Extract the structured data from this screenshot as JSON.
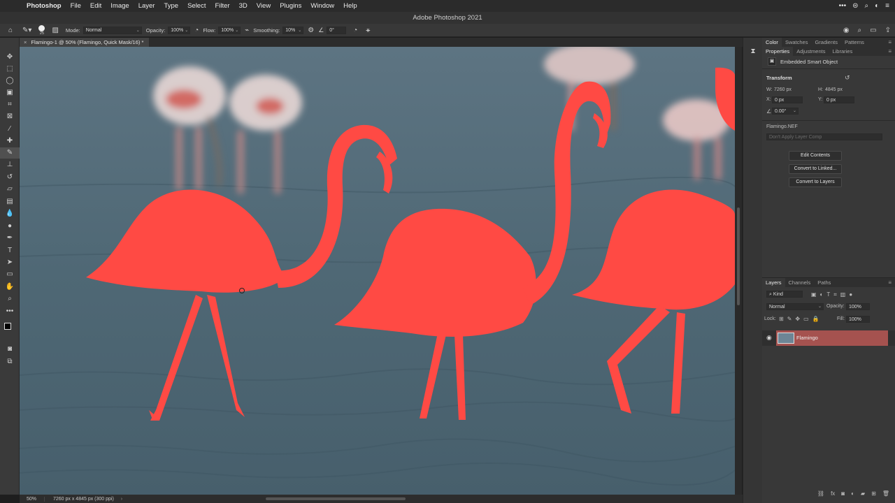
{
  "menubar": {
    "apple": "",
    "app_name": "Photoshop",
    "items": [
      "File",
      "Edit",
      "Image",
      "Layer",
      "Type",
      "Select",
      "Filter",
      "3D",
      "View",
      "Plugins",
      "Window",
      "Help"
    ]
  },
  "window": {
    "title": "Adobe Photoshop 2021"
  },
  "options": {
    "brush_size": "25",
    "mode_label": "Mode:",
    "mode_value": "Normal",
    "opacity_label": "Opacity:",
    "opacity_value": "100%",
    "flow_label": "Flow:",
    "flow_value": "100%",
    "smoothing_label": "Smoothing:",
    "smoothing_value": "10%",
    "angle_value": "0°"
  },
  "document": {
    "tab_title": "Flamingo-1 @ 50% (Flamingo, Quick Mask/16) *",
    "close_glyph": "×"
  },
  "statusbar": {
    "zoom": "50%",
    "dimensions": "7260 px x 4845 px (300 ppi)",
    "arrow": "›"
  },
  "panels": {
    "top_tabs": [
      "Color",
      "Swatches",
      "Gradients",
      "Patterns"
    ],
    "second_tabs": [
      "Properties",
      "Adjustments",
      "Libraries"
    ],
    "object_type": "Embedded Smart Object",
    "transform_title": "Transform",
    "w_label": "W:",
    "w_value": "7260 px",
    "h_label": "H:",
    "h_value": "4845 px",
    "x_label": "X:",
    "x_value": "0 px",
    "y_label": "Y:",
    "y_value": "0 px",
    "angle_value": "0.00°",
    "file_name": "Flamingo.NEF",
    "layer_comp_placeholder": "Don't Apply Layer Comp",
    "buttons": [
      "Edit Contents",
      "Convert to Linked...",
      "Convert to Layers"
    ]
  },
  "layers": {
    "tabs": [
      "Layers",
      "Channels",
      "Paths"
    ],
    "filter_kind": "Kind",
    "blend_mode": "Normal",
    "opacity_label": "Opacity:",
    "opacity_value": "100%",
    "lock_label": "Lock:",
    "fill_label": "Fill:",
    "fill_value": "100%",
    "items": [
      {
        "name": "Flamingo",
        "visible": true,
        "selected": true
      }
    ]
  },
  "colors": {
    "water": "#506978",
    "flamingo_mask": "#ff4a44",
    "selected_layer": "#a5524f"
  }
}
